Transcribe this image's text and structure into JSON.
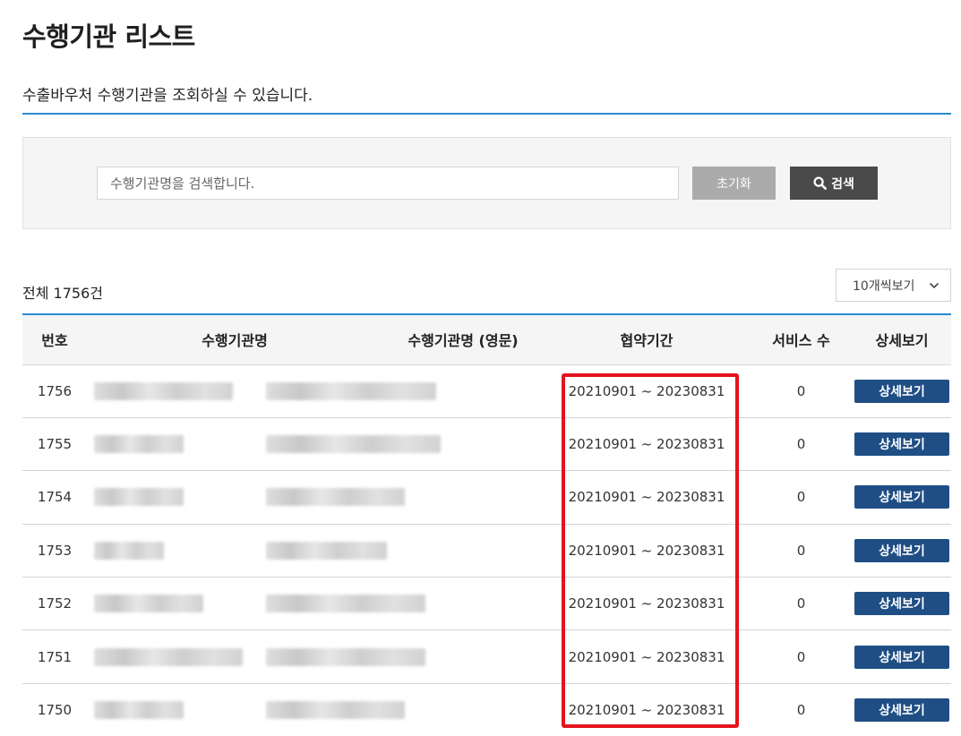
{
  "header": {
    "title": "수행기관 리스트",
    "description": "수출바우처 수행기관을 조회하실 수 있습니다."
  },
  "search": {
    "placeholder": "수행기관명을 검색합니다.",
    "value": "",
    "reset_label": "초기화",
    "search_label": "검색"
  },
  "summary": {
    "total_label": "전체 1756건"
  },
  "page_size": {
    "selected": "10개씩보기"
  },
  "table": {
    "columns": [
      "번호",
      "수행기관명",
      "수행기관명 (영문)",
      "협약기간",
      "서비스 수",
      "상세보기"
    ],
    "detail_label": "상세보기",
    "rows": [
      {
        "num": "1756",
        "period": "20210901 ~ 20230831",
        "services": "0"
      },
      {
        "num": "1755",
        "period": "20210901 ~ 20230831",
        "services": "0"
      },
      {
        "num": "1754",
        "period": "20210901 ~ 20230831",
        "services": "0"
      },
      {
        "num": "1753",
        "period": "20210901 ~ 20230831",
        "services": "0"
      },
      {
        "num": "1752",
        "period": "20210901 ~ 20230831",
        "services": "0"
      },
      {
        "num": "1751",
        "period": "20210901 ~ 20230831",
        "services": "0"
      },
      {
        "num": "1750",
        "period": "20210901 ~ 20230831",
        "services": "0"
      }
    ]
  },
  "colors": {
    "accent_blue": "#2a8ad2",
    "detail_button": "#1f4e85",
    "highlight_red": "#e4141e"
  },
  "icons": {
    "search": "search-icon",
    "dropdown": "chevron-down-icon"
  }
}
